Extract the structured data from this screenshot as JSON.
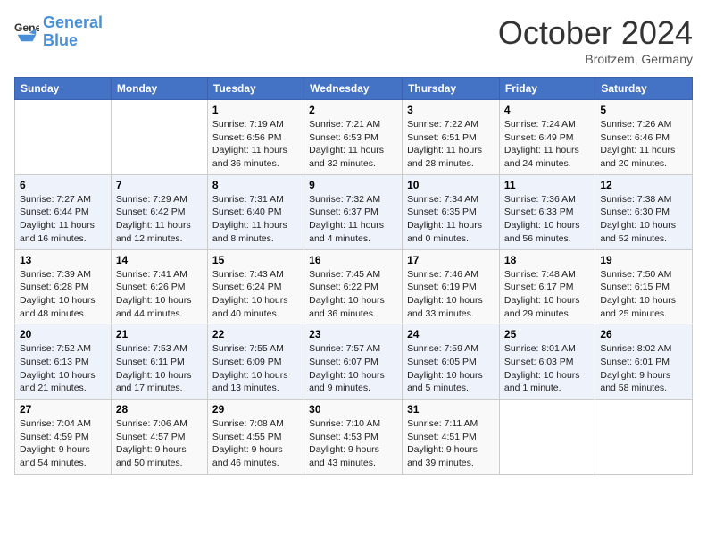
{
  "header": {
    "logo_line1": "General",
    "logo_line2": "Blue",
    "month": "October 2024",
    "location": "Broitzem, Germany"
  },
  "weekdays": [
    "Sunday",
    "Monday",
    "Tuesday",
    "Wednesday",
    "Thursday",
    "Friday",
    "Saturday"
  ],
  "weeks": [
    [
      {
        "day": "",
        "info": ""
      },
      {
        "day": "",
        "info": ""
      },
      {
        "day": "1",
        "info": "Sunrise: 7:19 AM\nSunset: 6:56 PM\nDaylight: 11 hours and 36 minutes."
      },
      {
        "day": "2",
        "info": "Sunrise: 7:21 AM\nSunset: 6:53 PM\nDaylight: 11 hours and 32 minutes."
      },
      {
        "day": "3",
        "info": "Sunrise: 7:22 AM\nSunset: 6:51 PM\nDaylight: 11 hours and 28 minutes."
      },
      {
        "day": "4",
        "info": "Sunrise: 7:24 AM\nSunset: 6:49 PM\nDaylight: 11 hours and 24 minutes."
      },
      {
        "day": "5",
        "info": "Sunrise: 7:26 AM\nSunset: 6:46 PM\nDaylight: 11 hours and 20 minutes."
      }
    ],
    [
      {
        "day": "6",
        "info": "Sunrise: 7:27 AM\nSunset: 6:44 PM\nDaylight: 11 hours and 16 minutes."
      },
      {
        "day": "7",
        "info": "Sunrise: 7:29 AM\nSunset: 6:42 PM\nDaylight: 11 hours and 12 minutes."
      },
      {
        "day": "8",
        "info": "Sunrise: 7:31 AM\nSunset: 6:40 PM\nDaylight: 11 hours and 8 minutes."
      },
      {
        "day": "9",
        "info": "Sunrise: 7:32 AM\nSunset: 6:37 PM\nDaylight: 11 hours and 4 minutes."
      },
      {
        "day": "10",
        "info": "Sunrise: 7:34 AM\nSunset: 6:35 PM\nDaylight: 11 hours and 0 minutes."
      },
      {
        "day": "11",
        "info": "Sunrise: 7:36 AM\nSunset: 6:33 PM\nDaylight: 10 hours and 56 minutes."
      },
      {
        "day": "12",
        "info": "Sunrise: 7:38 AM\nSunset: 6:30 PM\nDaylight: 10 hours and 52 minutes."
      }
    ],
    [
      {
        "day": "13",
        "info": "Sunrise: 7:39 AM\nSunset: 6:28 PM\nDaylight: 10 hours and 48 minutes."
      },
      {
        "day": "14",
        "info": "Sunrise: 7:41 AM\nSunset: 6:26 PM\nDaylight: 10 hours and 44 minutes."
      },
      {
        "day": "15",
        "info": "Sunrise: 7:43 AM\nSunset: 6:24 PM\nDaylight: 10 hours and 40 minutes."
      },
      {
        "day": "16",
        "info": "Sunrise: 7:45 AM\nSunset: 6:22 PM\nDaylight: 10 hours and 36 minutes."
      },
      {
        "day": "17",
        "info": "Sunrise: 7:46 AM\nSunset: 6:19 PM\nDaylight: 10 hours and 33 minutes."
      },
      {
        "day": "18",
        "info": "Sunrise: 7:48 AM\nSunset: 6:17 PM\nDaylight: 10 hours and 29 minutes."
      },
      {
        "day": "19",
        "info": "Sunrise: 7:50 AM\nSunset: 6:15 PM\nDaylight: 10 hours and 25 minutes."
      }
    ],
    [
      {
        "day": "20",
        "info": "Sunrise: 7:52 AM\nSunset: 6:13 PM\nDaylight: 10 hours and 21 minutes."
      },
      {
        "day": "21",
        "info": "Sunrise: 7:53 AM\nSunset: 6:11 PM\nDaylight: 10 hours and 17 minutes."
      },
      {
        "day": "22",
        "info": "Sunrise: 7:55 AM\nSunset: 6:09 PM\nDaylight: 10 hours and 13 minutes."
      },
      {
        "day": "23",
        "info": "Sunrise: 7:57 AM\nSunset: 6:07 PM\nDaylight: 10 hours and 9 minutes."
      },
      {
        "day": "24",
        "info": "Sunrise: 7:59 AM\nSunset: 6:05 PM\nDaylight: 10 hours and 5 minutes."
      },
      {
        "day": "25",
        "info": "Sunrise: 8:01 AM\nSunset: 6:03 PM\nDaylight: 10 hours and 1 minute."
      },
      {
        "day": "26",
        "info": "Sunrise: 8:02 AM\nSunset: 6:01 PM\nDaylight: 9 hours and 58 minutes."
      }
    ],
    [
      {
        "day": "27",
        "info": "Sunrise: 7:04 AM\nSunset: 4:59 PM\nDaylight: 9 hours and 54 minutes."
      },
      {
        "day": "28",
        "info": "Sunrise: 7:06 AM\nSunset: 4:57 PM\nDaylight: 9 hours and 50 minutes."
      },
      {
        "day": "29",
        "info": "Sunrise: 7:08 AM\nSunset: 4:55 PM\nDaylight: 9 hours and 46 minutes."
      },
      {
        "day": "30",
        "info": "Sunrise: 7:10 AM\nSunset: 4:53 PM\nDaylight: 9 hours and 43 minutes."
      },
      {
        "day": "31",
        "info": "Sunrise: 7:11 AM\nSunset: 4:51 PM\nDaylight: 9 hours and 39 minutes."
      },
      {
        "day": "",
        "info": ""
      },
      {
        "day": "",
        "info": ""
      }
    ]
  ]
}
